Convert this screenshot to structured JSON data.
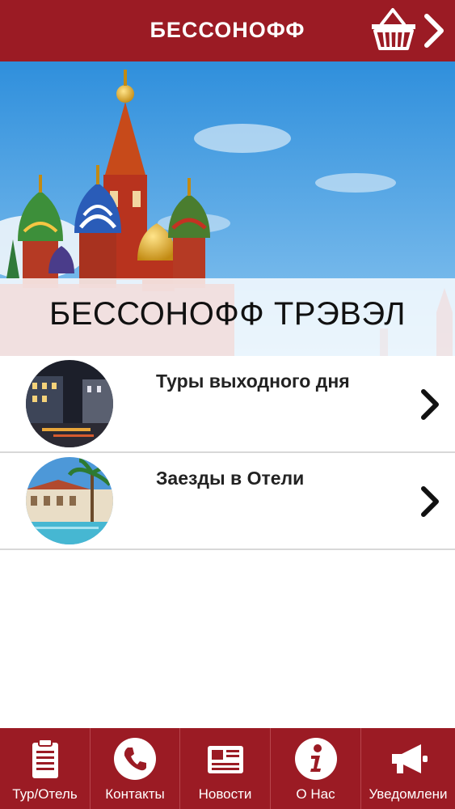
{
  "header": {
    "title": "БЕССОНОФФ",
    "cart_icon": "shopping-basket-icon",
    "next_icon": "chevron-right-icon"
  },
  "hero": {
    "title": "БЕССОНОФФ ТРЭВЭЛ",
    "image": "saint-basils-cathedral-photo"
  },
  "list": {
    "items": [
      {
        "label": "Туры выходного дня",
        "thumb": "night-city-photo"
      },
      {
        "label": "Заезды в Отели",
        "thumb": "hotel-palm-photo"
      }
    ]
  },
  "tabbar": {
    "tabs": [
      {
        "label": "Тур/Отель",
        "icon": "clipboard-icon"
      },
      {
        "label": "Контакты",
        "icon": "phone-icon"
      },
      {
        "label": "Новости",
        "icon": "newspaper-icon"
      },
      {
        "label": "О Нас",
        "icon": "info-icon"
      },
      {
        "label": "Уведомлени",
        "icon": "megaphone-icon"
      }
    ]
  },
  "colors": {
    "brand": "#9b1b24",
    "text": "#222222",
    "divider": "#d8d8d8"
  }
}
